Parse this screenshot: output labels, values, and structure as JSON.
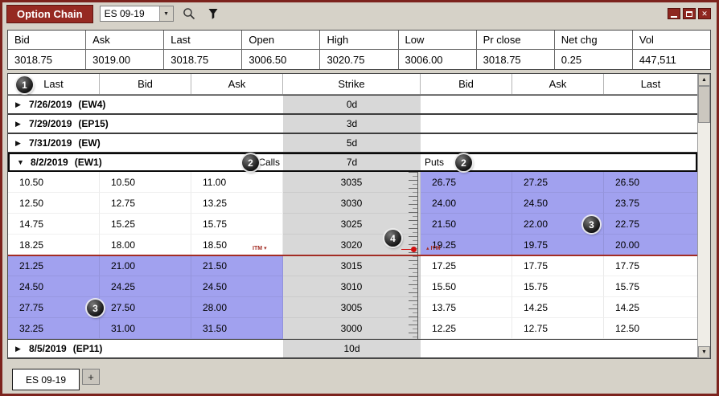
{
  "colors": {
    "maroon": "#962a22",
    "itm_highlight": "#a1a1ef",
    "strike_bg": "#d8d8d8",
    "price_line": "#a32c24",
    "chrome": "#d6d2c8"
  },
  "titlebar": {
    "title": "Option Chain",
    "symbol_selector": "ES 09-19"
  },
  "icons": {
    "dropdown": "▼",
    "expand": "▶",
    "collapse": "▼",
    "scroll_up": "▲",
    "scroll_down": "▼",
    "close": "✕",
    "itm_marker_down": "▾",
    "itm_marker_up": "▴"
  },
  "quote_bar": {
    "headers": [
      "Bid",
      "Ask",
      "Last",
      "Open",
      "High",
      "Low",
      "Pr close",
      "Net chg",
      "Vol"
    ],
    "values": [
      "3018.75",
      "3019.00",
      "3018.75",
      "3006.50",
      "3020.75",
      "3006.00",
      "3018.75",
      "0.25",
      "447,511"
    ]
  },
  "chain": {
    "headers": [
      "Last",
      "Bid",
      "Ask",
      "Strike",
      "Bid",
      "Ask",
      "Last"
    ],
    "groups": [
      {
        "state": "collapsed",
        "date": "7/26/2019",
        "code": "(EW4)",
        "dte": "0d"
      },
      {
        "state": "collapsed",
        "date": "7/29/2019",
        "code": "(EP15)",
        "dte": "3d"
      },
      {
        "state": "collapsed",
        "date": "7/31/2019",
        "code": "(EW)",
        "dte": "5d"
      },
      {
        "state": "expanded",
        "date": "8/2/2019",
        "code": "(EW1)",
        "dte": "7d",
        "calls_label": "Calls",
        "puts_label": "Puts"
      },
      {
        "state": "collapsed",
        "date": "8/5/2019",
        "code": "(EP11)",
        "dte": "10d"
      }
    ],
    "rows": [
      {
        "call_last": "10.50",
        "call_bid": "10.50",
        "call_ask": "11.00",
        "strike": "3035",
        "put_bid": "26.75",
        "put_ask": "27.25",
        "put_last": "26.50",
        "itm_side": "put"
      },
      {
        "call_last": "12.50",
        "call_bid": "12.75",
        "call_ask": "13.25",
        "strike": "3030",
        "put_bid": "24.00",
        "put_ask": "24.50",
        "put_last": "23.75",
        "itm_side": "put"
      },
      {
        "call_last": "14.75",
        "call_bid": "15.25",
        "call_ask": "15.75",
        "strike": "3025",
        "put_bid": "21.50",
        "put_ask": "22.00",
        "put_last": "22.75",
        "itm_side": "put"
      },
      {
        "call_last": "18.25",
        "call_bid": "18.00",
        "call_ask": "18.50",
        "strike": "3020",
        "put_bid": "19.25",
        "put_ask": "19.75",
        "put_last": "20.00",
        "itm_side": "put"
      },
      {
        "call_last": "21.25",
        "call_bid": "21.00",
        "call_ask": "21.50",
        "strike": "3015",
        "put_bid": "17.25",
        "put_ask": "17.75",
        "put_last": "17.75",
        "itm_side": "call"
      },
      {
        "call_last": "24.50",
        "call_bid": "24.25",
        "call_ask": "24.50",
        "strike": "3010",
        "put_bid": "15.50",
        "put_ask": "15.75",
        "put_last": "15.75",
        "itm_side": "call"
      },
      {
        "call_last": "27.75",
        "call_bid": "27.50",
        "call_ask": "28.00",
        "strike": "3005",
        "put_bid": "13.75",
        "put_ask": "14.25",
        "put_last": "14.25",
        "itm_side": "call"
      },
      {
        "call_last": "32.25",
        "call_bid": "31.00",
        "call_ask": "31.50",
        "strike": "3000",
        "put_bid": "12.25",
        "put_ask": "12.75",
        "put_last": "12.50",
        "itm_side": "call"
      }
    ],
    "itm_label": "ITM"
  },
  "annotations": [
    "1",
    "2",
    "2",
    "3",
    "3",
    "4"
  ],
  "tabs": {
    "active": "ES 09-19",
    "add": "+"
  }
}
